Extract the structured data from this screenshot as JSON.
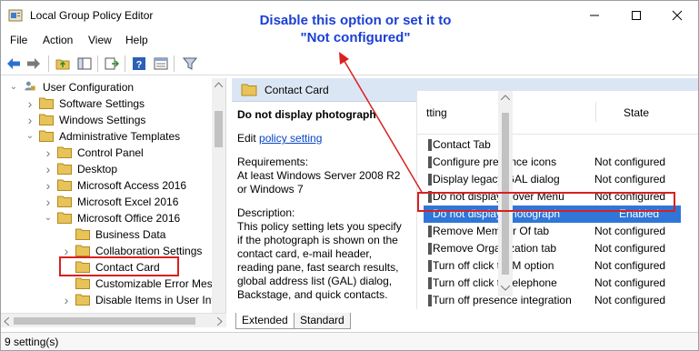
{
  "window": {
    "title": "Local Group Policy Editor",
    "minimize_icon": "minimize-icon",
    "maximize_icon": "maximize-icon",
    "close_icon": "close-icon"
  },
  "menu": [
    "File",
    "Action",
    "View",
    "Help"
  ],
  "toolbar": [
    "back-icon",
    "forward-icon",
    "up-folder-icon",
    "show-hide-tree-icon",
    "export-list-icon",
    "help-icon",
    "properties-icon",
    "filter-icon"
  ],
  "annotation": {
    "line1": "Disable this option or set it to",
    "line2": "\"Not configured\"",
    "color": "#1a3fd6"
  },
  "tree": {
    "root": "User Configuration",
    "items": [
      {
        "label": "Software Settings",
        "level": 1,
        "expander": "chevron-right"
      },
      {
        "label": "Windows Settings",
        "level": 1,
        "expander": "chevron-right"
      },
      {
        "label": "Administrative Templates",
        "level": 1,
        "expander": "chevron-down"
      },
      {
        "label": "Control Panel",
        "level": 2,
        "expander": "chevron-right"
      },
      {
        "label": "Desktop",
        "level": 2,
        "expander": "chevron-right"
      },
      {
        "label": "Microsoft Access 2016",
        "level": 2,
        "expander": "chevron-right"
      },
      {
        "label": "Microsoft Excel 2016",
        "level": 2,
        "expander": "chevron-right"
      },
      {
        "label": "Microsoft Office 2016",
        "level": 2,
        "expander": "chevron-down"
      },
      {
        "label": "Business Data",
        "level": 3,
        "expander": "none"
      },
      {
        "label": "Collaboration Settings",
        "level": 3,
        "expander": "chevron-right"
      },
      {
        "label": "Contact Card",
        "level": 3,
        "expander": "none",
        "selected": true
      },
      {
        "label": "Customizable Error Mess",
        "level": 3,
        "expander": "none"
      },
      {
        "label": "Disable Items in User Int",
        "level": 3,
        "expander": "chevron-right"
      }
    ]
  },
  "details": {
    "header": "Contact Card",
    "setting_title": "Do not display photograph",
    "edit_prefix": "Edit ",
    "edit_link": "policy setting",
    "requirements": "Requirements:\nAt least Windows Server 2008 R2 or Windows 7",
    "description": "Description:\nThis policy setting lets you specify if the photograph is shown on the contact card, e-mail header, reading pane, fast search results, global address list (GAL) dialog, Backstage, and quick contacts."
  },
  "list": {
    "col_setting": "tting",
    "col_state": "State",
    "rows": [
      {
        "name": "Contact Tab",
        "state": ""
      },
      {
        "name": "Configure presence icons",
        "state": "Not configured"
      },
      {
        "name": "Display legacy GAL dialog",
        "state": "Not configured"
      },
      {
        "name": "Do not display Hover Menu",
        "state": "Not configured"
      },
      {
        "name": "Do not display photograph",
        "state": "Enabled",
        "selected": true
      },
      {
        "name": "Remove Member Of tab",
        "state": "Not configured"
      },
      {
        "name": "Remove Organization tab",
        "state": "Not configured"
      },
      {
        "name": "Turn off click to IM option",
        "state": "Not configured"
      },
      {
        "name": "Turn off click to telephone",
        "state": "Not configured"
      },
      {
        "name": "Turn off presence integration",
        "state": "Not configured"
      }
    ]
  },
  "tabs": [
    "Extended",
    "Standard"
  ],
  "status": "9 setting(s)",
  "colors": {
    "selection": "#3076d8",
    "highlight": "#d92020",
    "header_band": "#dbe6f4"
  }
}
